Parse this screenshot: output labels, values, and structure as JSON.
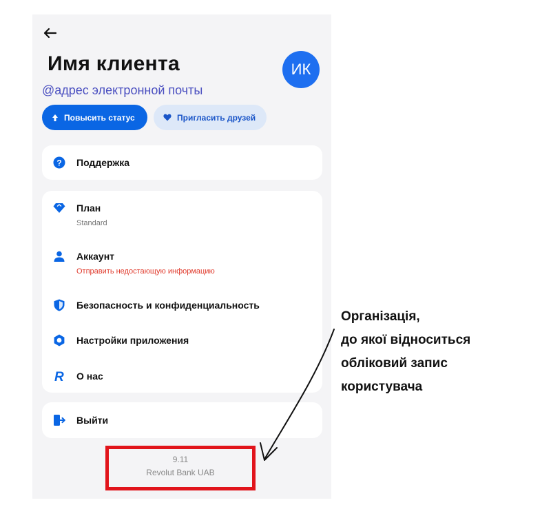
{
  "header": {
    "client_name": "Имя клиента",
    "email": "@адрес электронной почты",
    "avatar_initials": "ИК"
  },
  "actions": {
    "upgrade_label": "Повысить статус",
    "invite_label": "Пригласить друзей"
  },
  "menu": {
    "support": "Поддержка",
    "plan": "План",
    "plan_value": "Standard",
    "account": "Аккаунт",
    "account_note": "Отправить недостающую информацию",
    "security": "Безопасность и конфиденциальность",
    "settings": "Настройки приложения",
    "about": "О нас",
    "logout": "Выйти"
  },
  "footer": {
    "version": "9.11",
    "company": "Revolut Bank UAB"
  },
  "annotation": {
    "line1": "Організація,",
    "line2": "до якої відноситься",
    "line3": "обліковий запис",
    "line4": "користувача"
  },
  "colors": {
    "accent": "#0a66e4",
    "highlight_box": "#e1141b",
    "warning_text": "#e0392b"
  }
}
